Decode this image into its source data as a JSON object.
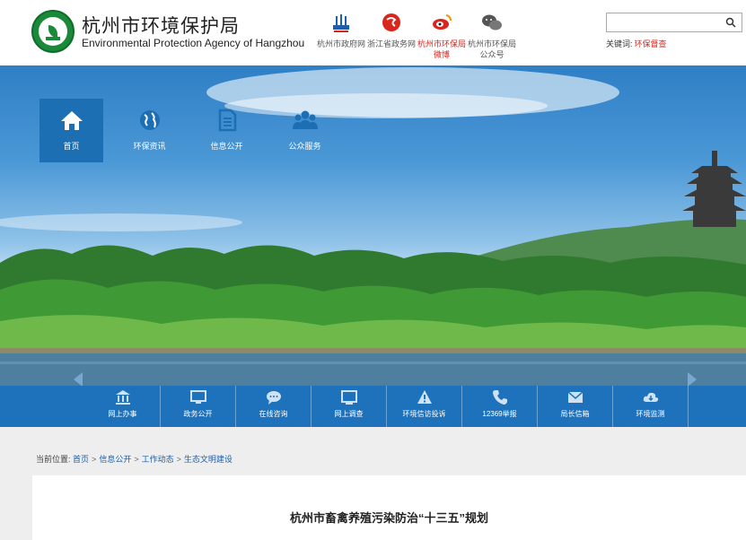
{
  "header": {
    "title_cn": "杭州市环境保护局",
    "title_en": "Environmental Protection Agency of Hangzhou"
  },
  "links": [
    {
      "label": "杭州市政府网",
      "icon": "gov-building-icon",
      "color": "#555555"
    },
    {
      "label": "浙江省政务网",
      "icon": "zhejiang-logo-icon",
      "color": "#555555"
    },
    {
      "label": "杭州市环保局微博",
      "icon": "weibo-icon",
      "color": "#d9251c"
    },
    {
      "label": "杭州市环保局公众号",
      "icon": "wechat-icon",
      "color": "#555555"
    }
  ],
  "search": {
    "placeholder": "",
    "keywords_label": "关键词:",
    "keyword": "环保督查"
  },
  "nav": [
    {
      "label": "首页",
      "icon": "home-icon"
    },
    {
      "label": "环保资讯",
      "icon": "globe-icon"
    },
    {
      "label": "信息公开",
      "icon": "document-icon"
    },
    {
      "label": "公众服务",
      "icon": "people-icon"
    }
  ],
  "services": [
    {
      "label": "网上办事",
      "icon": "bank-icon"
    },
    {
      "label": "政务公开",
      "icon": "monitor-icon"
    },
    {
      "label": "在线咨询",
      "icon": "chat-icon"
    },
    {
      "label": "网上调查",
      "icon": "screen-icon"
    },
    {
      "label": "环境信访投诉",
      "icon": "warning-icon"
    },
    {
      "label": "12369举报",
      "icon": "phone-icon"
    },
    {
      "label": "局长信箱",
      "icon": "mail-icon"
    },
    {
      "label": "环境监测",
      "icon": "cloud-icon"
    }
  ],
  "breadcrumb": {
    "prefix": "当前位置:",
    "items": [
      "首页",
      "信息公开",
      "工作动态",
      "生态文明建设"
    ],
    "separator": ">"
  },
  "article": {
    "title": "杭州市畜禽养殖污染防治“十三五”规划"
  },
  "colors": {
    "accent_blue": "#1e72bb",
    "nav_active": "#1d6fb3",
    "link_red": "#d9251c",
    "logo_green": "#1a8a3a"
  }
}
